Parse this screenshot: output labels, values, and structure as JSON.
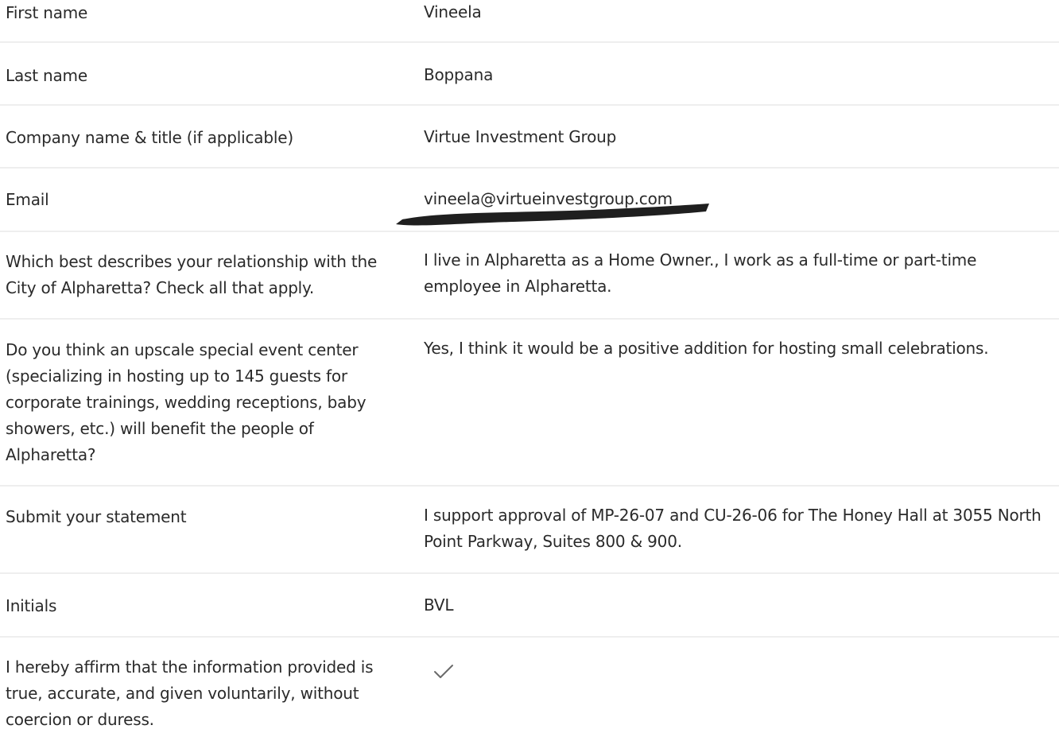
{
  "fields": [
    {
      "label": "First name",
      "value": "Vineela"
    },
    {
      "label": "Last name",
      "value": "Boppana"
    },
    {
      "label": "Company name & title (if applicable)",
      "value": "Virtue Investment Group"
    },
    {
      "label": "Email",
      "value": "vineela@virtueinvestgroup.com"
    },
    {
      "label": "Which best describes your relationship with the City of Alpharetta? Check all that apply.",
      "value": "I live in Alpharetta as a Home Owner., I work as a full-time or part-time employee in Alpharetta."
    },
    {
      "label": "Do you think an upscale special event center (specializing in hosting up to 145 guests for corporate trainings, wedding receptions, baby showers, etc.) will benefit the people of Alpharetta?",
      "value": "Yes, I think it would be a positive addition for hosting small celebrations."
    },
    {
      "label": "Submit your statement",
      "value": "I support approval of MP-26-07 and CU-26-06 for The Honey Hall at 3055 North Point Parkway, Suites 800 & 900."
    },
    {
      "label": "Initials",
      "value": "BVL"
    },
    {
      "label": "I hereby affirm that the information provided is true, accurate, and given voluntarily, without coercion or duress.",
      "checked": true
    }
  ]
}
